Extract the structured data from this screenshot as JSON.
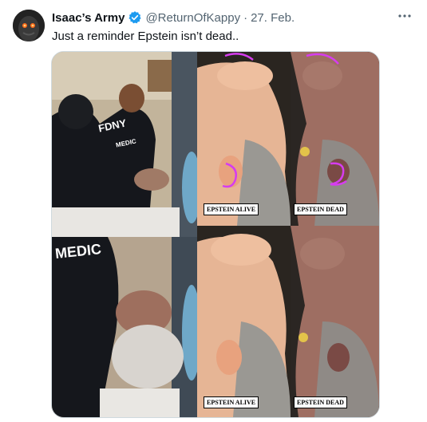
{
  "tweet": {
    "author_name": "Isaac’s Army",
    "handle": "@ReturnOfKappy",
    "separator": "·",
    "date": "27. Feb.",
    "text": "Just a reminder Epstein isn’t dead..",
    "more_icon": "more-horizontal-icon",
    "verified_icon": "verified-badge-icon"
  },
  "media": {
    "captions": {
      "top_middle": "EPSTEIN ALIVE",
      "top_right": "EPSTEIN DEAD",
      "bottom_middle": "EPSTEIN ALIVE",
      "bottom_right": "EPSTEIN DEAD"
    },
    "jacket_top": "FDNY",
    "jacket_top_sub": "MEDIC",
    "jacket_bottom": "MEDIC"
  },
  "colors": {
    "verified": "#1d9bf0",
    "secondary_text": "#536471",
    "highlight": "#d63cf0"
  }
}
